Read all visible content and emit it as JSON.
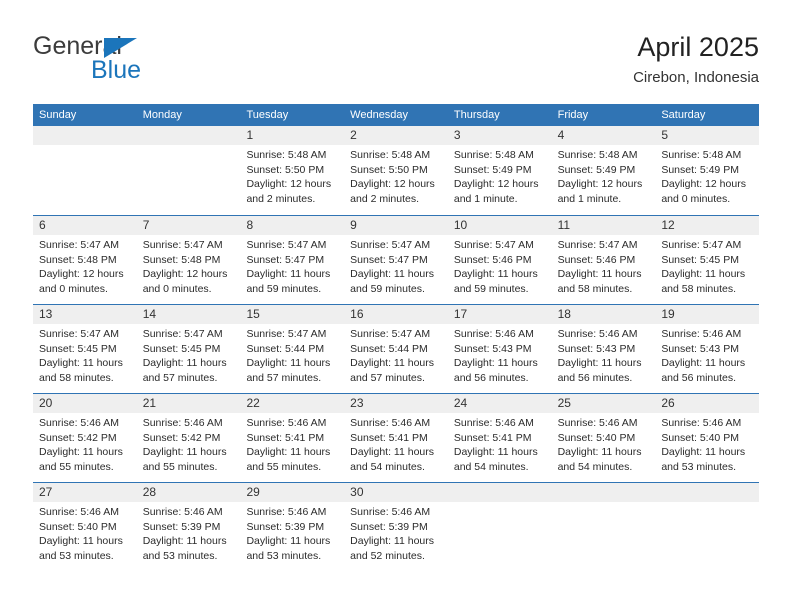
{
  "logo": {
    "word_one": "General",
    "word_two": "Blue",
    "triangle_icon": "blue-triangle-icon",
    "brand_color": "#1b75bb"
  },
  "header": {
    "title": "April 2025",
    "subtitle": "Cirebon, Indonesia"
  },
  "theme": {
    "header_blue": "#3074b4",
    "day_strip_gray": "#efefef",
    "text_color": "#2b2b2b"
  },
  "calendar": {
    "weekdays": [
      "Sunday",
      "Monday",
      "Tuesday",
      "Wednesday",
      "Thursday",
      "Friday",
      "Saturday"
    ],
    "weeks": [
      [
        {
          "empty": true
        },
        {
          "empty": true
        },
        {
          "day": "1",
          "sunrise": "Sunrise: 5:48 AM",
          "sunset": "Sunset: 5:50 PM",
          "daylight": "Daylight: 12 hours and 2 minutes."
        },
        {
          "day": "2",
          "sunrise": "Sunrise: 5:48 AM",
          "sunset": "Sunset: 5:50 PM",
          "daylight": "Daylight: 12 hours and 2 minutes."
        },
        {
          "day": "3",
          "sunrise": "Sunrise: 5:48 AM",
          "sunset": "Sunset: 5:49 PM",
          "daylight": "Daylight: 12 hours and 1 minute."
        },
        {
          "day": "4",
          "sunrise": "Sunrise: 5:48 AM",
          "sunset": "Sunset: 5:49 PM",
          "daylight": "Daylight: 12 hours and 1 minute."
        },
        {
          "day": "5",
          "sunrise": "Sunrise: 5:48 AM",
          "sunset": "Sunset: 5:49 PM",
          "daylight": "Daylight: 12 hours and 0 minutes."
        }
      ],
      [
        {
          "day": "6",
          "sunrise": "Sunrise: 5:47 AM",
          "sunset": "Sunset: 5:48 PM",
          "daylight": "Daylight: 12 hours and 0 minutes."
        },
        {
          "day": "7",
          "sunrise": "Sunrise: 5:47 AM",
          "sunset": "Sunset: 5:48 PM",
          "daylight": "Daylight: 12 hours and 0 minutes."
        },
        {
          "day": "8",
          "sunrise": "Sunrise: 5:47 AM",
          "sunset": "Sunset: 5:47 PM",
          "daylight": "Daylight: 11 hours and 59 minutes."
        },
        {
          "day": "9",
          "sunrise": "Sunrise: 5:47 AM",
          "sunset": "Sunset: 5:47 PM",
          "daylight": "Daylight: 11 hours and 59 minutes."
        },
        {
          "day": "10",
          "sunrise": "Sunrise: 5:47 AM",
          "sunset": "Sunset: 5:46 PM",
          "daylight": "Daylight: 11 hours and 59 minutes."
        },
        {
          "day": "11",
          "sunrise": "Sunrise: 5:47 AM",
          "sunset": "Sunset: 5:46 PM",
          "daylight": "Daylight: 11 hours and 58 minutes."
        },
        {
          "day": "12",
          "sunrise": "Sunrise: 5:47 AM",
          "sunset": "Sunset: 5:45 PM",
          "daylight": "Daylight: 11 hours and 58 minutes."
        }
      ],
      [
        {
          "day": "13",
          "sunrise": "Sunrise: 5:47 AM",
          "sunset": "Sunset: 5:45 PM",
          "daylight": "Daylight: 11 hours and 58 minutes."
        },
        {
          "day": "14",
          "sunrise": "Sunrise: 5:47 AM",
          "sunset": "Sunset: 5:45 PM",
          "daylight": "Daylight: 11 hours and 57 minutes."
        },
        {
          "day": "15",
          "sunrise": "Sunrise: 5:47 AM",
          "sunset": "Sunset: 5:44 PM",
          "daylight": "Daylight: 11 hours and 57 minutes."
        },
        {
          "day": "16",
          "sunrise": "Sunrise: 5:47 AM",
          "sunset": "Sunset: 5:44 PM",
          "daylight": "Daylight: 11 hours and 57 minutes."
        },
        {
          "day": "17",
          "sunrise": "Sunrise: 5:46 AM",
          "sunset": "Sunset: 5:43 PM",
          "daylight": "Daylight: 11 hours and 56 minutes."
        },
        {
          "day": "18",
          "sunrise": "Sunrise: 5:46 AM",
          "sunset": "Sunset: 5:43 PM",
          "daylight": "Daylight: 11 hours and 56 minutes."
        },
        {
          "day": "19",
          "sunrise": "Sunrise: 5:46 AM",
          "sunset": "Sunset: 5:43 PM",
          "daylight": "Daylight: 11 hours and 56 minutes."
        }
      ],
      [
        {
          "day": "20",
          "sunrise": "Sunrise: 5:46 AM",
          "sunset": "Sunset: 5:42 PM",
          "daylight": "Daylight: 11 hours and 55 minutes."
        },
        {
          "day": "21",
          "sunrise": "Sunrise: 5:46 AM",
          "sunset": "Sunset: 5:42 PM",
          "daylight": "Daylight: 11 hours and 55 minutes."
        },
        {
          "day": "22",
          "sunrise": "Sunrise: 5:46 AM",
          "sunset": "Sunset: 5:41 PM",
          "daylight": "Daylight: 11 hours and 55 minutes."
        },
        {
          "day": "23",
          "sunrise": "Sunrise: 5:46 AM",
          "sunset": "Sunset: 5:41 PM",
          "daylight": "Daylight: 11 hours and 54 minutes."
        },
        {
          "day": "24",
          "sunrise": "Sunrise: 5:46 AM",
          "sunset": "Sunset: 5:41 PM",
          "daylight": "Daylight: 11 hours and 54 minutes."
        },
        {
          "day": "25",
          "sunrise": "Sunrise: 5:46 AM",
          "sunset": "Sunset: 5:40 PM",
          "daylight": "Daylight: 11 hours and 54 minutes."
        },
        {
          "day": "26",
          "sunrise": "Sunrise: 5:46 AM",
          "sunset": "Sunset: 5:40 PM",
          "daylight": "Daylight: 11 hours and 53 minutes."
        }
      ],
      [
        {
          "day": "27",
          "sunrise": "Sunrise: 5:46 AM",
          "sunset": "Sunset: 5:40 PM",
          "daylight": "Daylight: 11 hours and 53 minutes."
        },
        {
          "day": "28",
          "sunrise": "Sunrise: 5:46 AM",
          "sunset": "Sunset: 5:39 PM",
          "daylight": "Daylight: 11 hours and 53 minutes."
        },
        {
          "day": "29",
          "sunrise": "Sunrise: 5:46 AM",
          "sunset": "Sunset: 5:39 PM",
          "daylight": "Daylight: 11 hours and 53 minutes."
        },
        {
          "day": "30",
          "sunrise": "Sunrise: 5:46 AM",
          "sunset": "Sunset: 5:39 PM",
          "daylight": "Daylight: 11 hours and 52 minutes."
        },
        {
          "empty": true
        },
        {
          "empty": true
        },
        {
          "empty": true
        }
      ]
    ]
  }
}
